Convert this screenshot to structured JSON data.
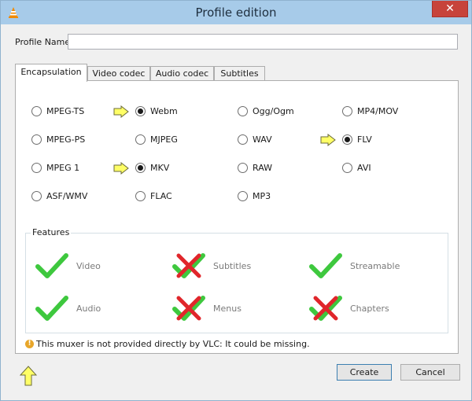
{
  "window": {
    "title": "Profile edition",
    "close_glyph": "✕"
  },
  "profile_name": {
    "label": "Profile Name",
    "value": ""
  },
  "tabs": [
    {
      "label": "Encapsulation",
      "active": true
    },
    {
      "label": "Video codec",
      "active": false
    },
    {
      "label": "Audio codec",
      "active": false
    },
    {
      "label": "Subtitles",
      "active": false
    }
  ],
  "encapsulation": {
    "options": [
      {
        "label": "MPEG-TS",
        "checked": false
      },
      {
        "label": "Webm",
        "checked": true
      },
      {
        "label": "Ogg/Ogm",
        "checked": false
      },
      {
        "label": "MP4/MOV",
        "checked": false
      },
      {
        "label": "MPEG-PS",
        "checked": false
      },
      {
        "label": "MJPEG",
        "checked": false
      },
      {
        "label": "WAV",
        "checked": false
      },
      {
        "label": "FLV",
        "checked": true
      },
      {
        "label": "MPEG 1",
        "checked": false
      },
      {
        "label": "MKV",
        "checked": true
      },
      {
        "label": "RAW",
        "checked": false
      },
      {
        "label": "AVI",
        "checked": false
      },
      {
        "label": "ASF/WMV",
        "checked": false
      },
      {
        "label": "FLAC",
        "checked": false
      },
      {
        "label": "MP3",
        "checked": false
      }
    ]
  },
  "features": {
    "legend": "Features",
    "items": [
      {
        "label": "Video",
        "supported": true
      },
      {
        "label": "Subtitles",
        "supported": false
      },
      {
        "label": "Streamable",
        "supported": true
      },
      {
        "label": "Audio",
        "supported": true
      },
      {
        "label": "Menus",
        "supported": false
      },
      {
        "label": "Chapters",
        "supported": false
      }
    ]
  },
  "warning": {
    "icon": "warning-icon",
    "text": "This muxer is not provided directly by VLC: It could be missing."
  },
  "buttons": {
    "create": "Create",
    "cancel": "Cancel"
  },
  "colors": {
    "check": "#3ec83e",
    "cross": "#e0262b",
    "highlight_arrow": "#ffff66"
  }
}
